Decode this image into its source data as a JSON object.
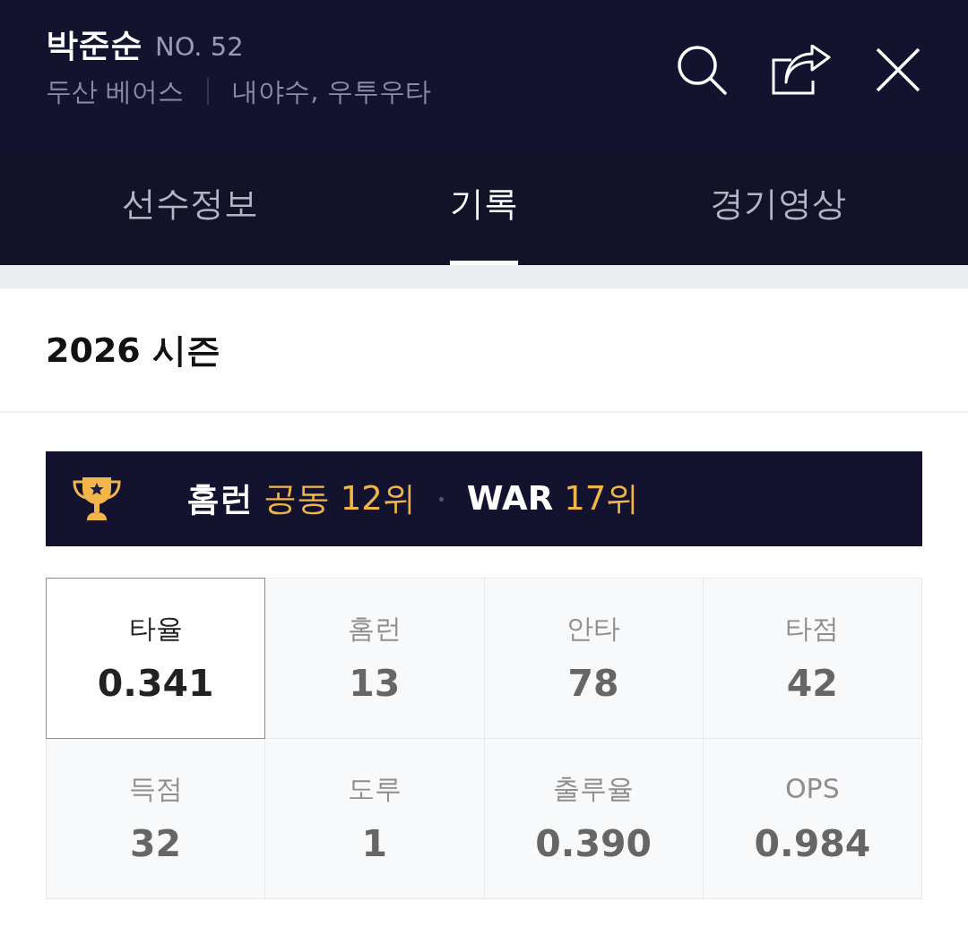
{
  "header": {
    "player_name": "박준순",
    "number": "NO. 52",
    "team": "두산 베어스",
    "position": "내야수, 우투우타"
  },
  "tabs": [
    {
      "label": "선수정보",
      "selected": false
    },
    {
      "label": "기록",
      "selected": true
    },
    {
      "label": "경기영상",
      "selected": false
    }
  ],
  "season": {
    "title": "2026 시즌"
  },
  "ranking_banner": {
    "items": [
      {
        "stat": "홈런",
        "rank": "공동 12위"
      },
      {
        "stat": "WAR",
        "rank": "17위"
      }
    ]
  },
  "stats": [
    {
      "label": "타율",
      "value": "0.341",
      "selected": true
    },
    {
      "label": "홈런",
      "value": "13",
      "selected": false
    },
    {
      "label": "안타",
      "value": "78",
      "selected": false
    },
    {
      "label": "타점",
      "value": "42",
      "selected": false
    },
    {
      "label": "득점",
      "value": "32",
      "selected": false
    },
    {
      "label": "도루",
      "value": "1",
      "selected": false
    },
    {
      "label": "출루율",
      "value": "0.390",
      "selected": false
    },
    {
      "label": "OPS",
      "value": "0.984",
      "selected": false
    }
  ]
}
